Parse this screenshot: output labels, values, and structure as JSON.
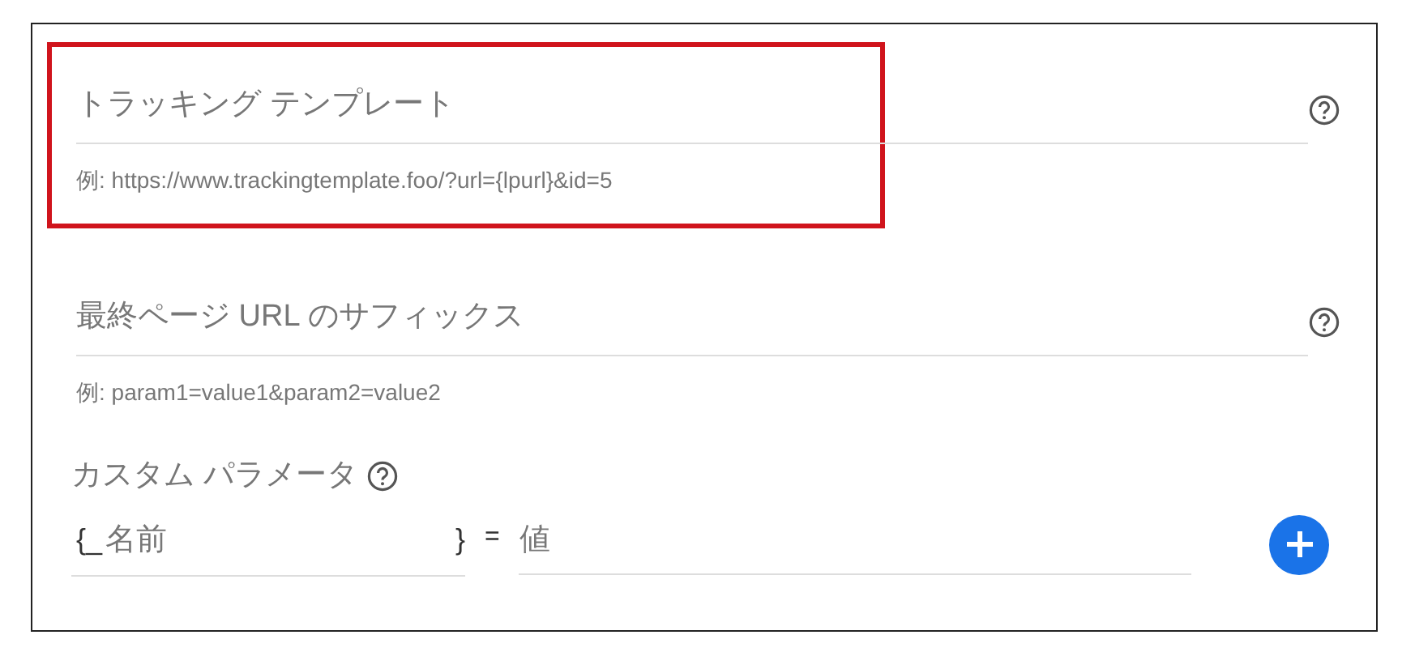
{
  "fields": [
    {
      "placeholder": "トラッキング テンプレート",
      "hint": "例: https://www.trackingtemplate.foo/?url={lpurl}&id=5",
      "highlighted": true
    },
    {
      "placeholder": "最終ページ URL のサフィックス",
      "hint": "例: param1=value1&param2=value2",
      "highlighted": false
    }
  ],
  "custom_parameters": {
    "label": "カスタム パラメータ",
    "prefix": "{_",
    "name_placeholder": "名前",
    "suffix": "}",
    "equals": "=",
    "value_placeholder": "値"
  }
}
